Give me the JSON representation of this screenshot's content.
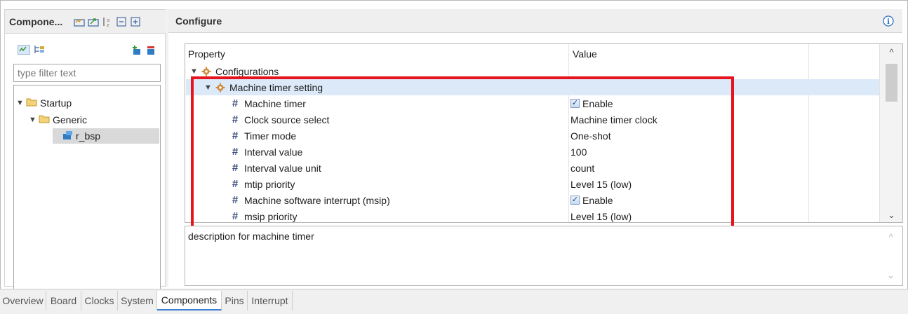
{
  "component_panel": {
    "title": "Compone...",
    "filter_placeholder": "type filter text",
    "tree": [
      {
        "label": "Startup"
      },
      {
        "label": "Generic"
      },
      {
        "label": "r_bsp"
      }
    ]
  },
  "configure": {
    "title": "Configure",
    "columns": {
      "property": "Property",
      "value": "Value"
    },
    "rows": [
      {
        "property": "Configurations",
        "value": ""
      },
      {
        "property": "Machine timer setting",
        "value": ""
      },
      {
        "property": "Machine timer",
        "value": "Enable"
      },
      {
        "property": "Clock source select",
        "value": "Machine timer clock"
      },
      {
        "property": "Timer mode",
        "value": "One-shot"
      },
      {
        "property": "Interval value",
        "value": "100"
      },
      {
        "property": "Interval value unit",
        "value": "count"
      },
      {
        "property": "mtip priority",
        "value": "Level 15 (low)"
      },
      {
        "property": "Machine software interrupt (msip)",
        "value": "Enable"
      },
      {
        "property": "msip priority",
        "value": "Level 15 (low)"
      }
    ],
    "description": "description for machine timer"
  },
  "tabs": [
    "Overview",
    "Board",
    "Clocks",
    "System",
    "Components",
    "Pins",
    "Interrupt"
  ],
  "active_tab": "Components",
  "colors": {
    "highlight": "#e8141d",
    "selected_row": "#dbe9f9",
    "active_tab_underline": "#3c7fd6"
  }
}
